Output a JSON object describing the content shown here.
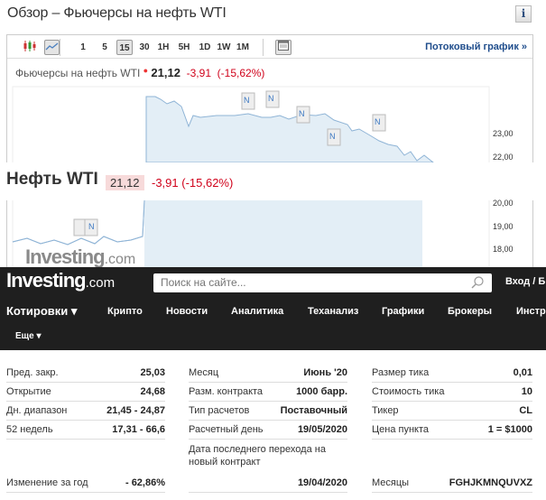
{
  "title": "Обзор – Фьючерсы на нефть WTI",
  "info_label": "i",
  "toolbar": {
    "intervals": [
      "1",
      "5",
      "15",
      "30",
      "1H",
      "5H",
      "1D",
      "1W",
      "1M"
    ],
    "selected": "15",
    "stream_label": "Потоковый график »"
  },
  "quote": {
    "name": "Фьючерсы на нефть WTI",
    "price": "21,12",
    "change": "-3,91",
    "change_pct": "(-15,62%)"
  },
  "y_labels": [
    "23,00",
    "22,00",
    "20,00",
    "19,00",
    "18,00"
  ],
  "news_marker": "N",
  "header": {
    "name": "Нефть WTI",
    "price": "21,12",
    "change": "-3,91 (-15,62%)"
  },
  "watermark": "Investing.com",
  "colors": {
    "accent_red": "#d0021b",
    "link_blue": "#1f4d8c",
    "nav_bg": "#1f1f1f",
    "chart_fill": "#e3eef6"
  },
  "site": {
    "logo": "Investing.com",
    "search_placeholder": "Поиск на сайте...",
    "login": "Вход / Б",
    "nav": [
      "Котировки ▾",
      "Крипто",
      "Новости",
      "Аналитика",
      "Теханализ",
      "Графики",
      "Брокеры",
      "Инстр"
    ],
    "more": "Еще ▾"
  },
  "stats": {
    "col1": [
      {
        "k": "Пред. закр.",
        "v": "25,03"
      },
      {
        "k": "Открытие",
        "v": "24,68"
      },
      {
        "k": "Дн. диапазон",
        "v": "21,45 - 24,87"
      },
      {
        "k": "52 недель",
        "v": "17,31 - 66,6"
      },
      {
        "k": "Изменение за год",
        "v": "- 62,86%"
      }
    ],
    "col2": [
      {
        "k": "Месяц",
        "v": "Июнь '20"
      },
      {
        "k": "Разм. контракта",
        "v": "1000 барр."
      },
      {
        "k": "Тип расчетов",
        "v": "Поставочный"
      },
      {
        "k": "Расчетный день",
        "v": "19/05/2020"
      },
      {
        "k": "Дата последнего перехода на новый контракт",
        "v": "19/04/2020"
      }
    ],
    "col3": [
      {
        "k": "Размер тика",
        "v": "0,01"
      },
      {
        "k": "Стоимость тика",
        "v": "10"
      },
      {
        "k": "Тикер",
        "v": "CL"
      },
      {
        "k": "Цена пункта",
        "v": "1 = $1000"
      },
      {
        "k": "Месяцы",
        "v": "FGHJKMNQUVXZ"
      }
    ]
  }
}
